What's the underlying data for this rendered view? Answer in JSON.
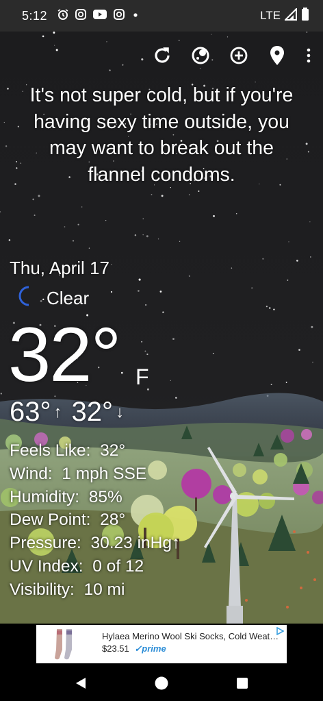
{
  "status_bar": {
    "time": "5:12",
    "network": "LTE",
    "icons": [
      "alarm-icon",
      "instagram-icon",
      "youtube-icon",
      "instagram-icon",
      "dot-icon"
    ]
  },
  "toolbar": {
    "icons": [
      "refresh-icon",
      "theme-icon",
      "add-location-icon",
      "location-pin-icon",
      "more-icon"
    ]
  },
  "headline": "It's not super cold, but if you're having sexy time outside, you may want to break out the flannel condoms.",
  "weather": {
    "date": "Thu, April 17",
    "condition": "Clear",
    "condition_icon": "moon-icon",
    "temperature": "32°",
    "unit": "F",
    "high": "63°",
    "low": "32°"
  },
  "details": [
    {
      "label": "Feels Like:",
      "value": "32°"
    },
    {
      "label": "Wind:",
      "value": "1 mph SSE"
    },
    {
      "label": "Humidity:",
      "value": "85%"
    },
    {
      "label": "Dew Point:",
      "value": "28°"
    },
    {
      "label": "Pressure:",
      "value": "30.23 inHg↑"
    },
    {
      "label": "UV Index:",
      "value": "0 of 12"
    },
    {
      "label": "Visibility:",
      "value": "10 mi"
    }
  ],
  "ad": {
    "title": "Hylaea Merino Wool Ski Socks, Cold Weather Socks",
    "price": "$23.51",
    "prime": "prime"
  },
  "nav": {
    "icons": [
      "back-icon",
      "home-icon",
      "recents-icon"
    ]
  },
  "colors": {
    "sky": "#1d1d1f",
    "hills": "#4f6b3f",
    "ad_prime": "#2a8cd6"
  }
}
